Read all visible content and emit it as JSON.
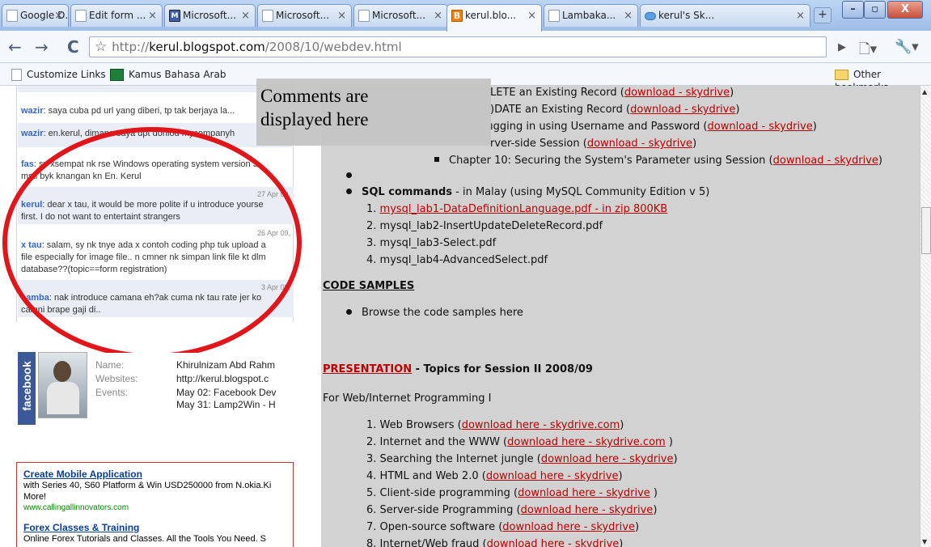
{
  "browser": {
    "tabs": [
      {
        "label": "Google D...",
        "icon": "page-icon"
      },
      {
        "label": "Edit form ...",
        "icon": "page-icon"
      },
      {
        "label": "Microsoft...",
        "icon": "ms-icon"
      },
      {
        "label": "Microsoft...",
        "icon": "page-icon"
      },
      {
        "label": "Microsoft...",
        "icon": "page-icon"
      },
      {
        "label": "kerul.blo...",
        "icon": "blogger-icon",
        "active": true
      },
      {
        "label": "Lambaka...",
        "icon": "page-icon"
      },
      {
        "label": "kerul's Sk...",
        "icon": "skydrive-icon"
      }
    ],
    "tab_close": "×",
    "new_tab": "+",
    "window_buttons": {
      "minimize": "–",
      "maximize": "▫",
      "close": "X"
    },
    "nav": {
      "back": "←",
      "forward": "→",
      "reload": "C",
      "star": "☆"
    },
    "url": {
      "scheme": "http://",
      "host": "kerul.blogspot.com",
      "path": "/2008/10/webdev.html"
    },
    "tools": {
      "play": "▶",
      "page": "🗋▾",
      "wrench": "🔧▾"
    },
    "bookmarks": [
      {
        "label": "Customize Links"
      },
      {
        "label": "Kamus Bahasa Arab"
      }
    ],
    "other_bookmarks": "Other bookmarks"
  },
  "comments": [
    {
      "user": "wazir",
      "text": ": saya cuba pd url yang diberi, tp tak berjaya la...",
      "date": ""
    },
    {
      "user": "wazir",
      "text": ": en.kerul, dimana saya dpt donlod mycompanyh",
      "date": ""
    },
    {
      "user": "fas",
      "text": ": sy xsempat nk rse Windows operating system version 3.",
      "text2": "msti byk knangan kn En. Kerul",
      "date": ""
    },
    {
      "user": "kerul",
      "text": ": dear x tau, it would be more polite if u introduce yourse",
      "text2": "first. I do not want to entertaint strangers",
      "date": "27 Apr 09,"
    },
    {
      "user": "x tau",
      "text": ": salam, sy nk tnye ada x contoh coding php tuk upload a",
      "text2": "file especially for image file.. n cmner nk simpan link file kt dlm",
      "text3": "database??(topic==form registration)",
      "date": "26 Apr 09,"
    },
    {
      "user": "samba",
      "text": ": nak introduce camana eh?ak cuma nk tau rate jer ko",
      "text2": "camni brape gaji di..",
      "date": "3 Apr 09,"
    }
  ],
  "annotation": {
    "line1": "Comments are",
    "line2": "displayed here",
    "ring_color": "#e0161b"
  },
  "profile": {
    "badge": "facebook",
    "labels": {
      "name": "Name:",
      "websites": "Websites:",
      "events": "Events:"
    },
    "name": "Khirulnizam Abd Rahm",
    "website": "http://kerul.blogspot.c",
    "event1": "May 02: Facebook Dev",
    "event2": "May 31: Lamp2Win - H"
  },
  "ads": [
    {
      "title": "Create Mobile Application",
      "body": "with Series 40, S60 Platform & Win USD250000 from N.okia.Ki",
      "body2": "More!",
      "url": "www.callingallinnovators.com"
    },
    {
      "title": "Forex Classes & Training",
      "body": "Online Forex Tutorials and Classes. All the Tools You Need. S"
    }
  ],
  "content": {
    "chapters": [
      {
        "text": "LETE an Existing Record (",
        "link": "download - skydrive",
        "tail": ")"
      },
      {
        "text": ")DATE an Existing Record (",
        "link": "download - skydrive",
        "tail": ")"
      },
      {
        "text": "ıgging in using Username and Password (",
        "link": "download - skydrive",
        "tail": ")"
      },
      {
        "text": "rver-side Session (",
        "link": "download - skydrive",
        "tail": ")"
      },
      {
        "text": "Chapter 10: Securing the System's Parameter using Session (",
        "link": "download - skydrive",
        "tail": ")"
      }
    ],
    "sql": {
      "title": "SQL commands",
      "desc": " - in Malay (using MySQL Community Edition v 5)",
      "items": [
        {
          "num": "1.",
          "text": "mysql_lab1-DataDefinitionLanguage.pdf - in zip 800KB",
          "link": true
        },
        {
          "num": "2.",
          "text": "mysql_lab2-InsertUpdateDeleteRecord.pdf"
        },
        {
          "num": "3.",
          "text": "mysql_lab3-Select.pdf"
        },
        {
          "num": "4.",
          "text": "mysql_lab4-AdvancedSelect.pdf"
        }
      ]
    },
    "code_heading": "CODE SAMPLES",
    "code_item": "Browse the code samples here",
    "presentation": {
      "title": "PRESENTATION",
      "desc": " - Topics for Session II 2008/09"
    },
    "for_line": "For Web/Internet Programming I",
    "topics": [
      {
        "num": "1.",
        "text": "Web Browsers (",
        "link": "download here - skydrive.com",
        "tail": ")"
      },
      {
        "num": "2.",
        "text": "Internet and the WWW (",
        "link": "download here - skydrive.com",
        "tail": " )"
      },
      {
        "num": "3.",
        "text": "Searching the Internet jungle (",
        "link": "download here - skydrive",
        "tail": ")"
      },
      {
        "num": "4.",
        "text": "HTML and Web 2.0 (",
        "link": "download here - skydrive",
        "tail": ")"
      },
      {
        "num": "5.",
        "text": "Client-side programming (",
        "link": "download here - skydrive",
        "tail": " )"
      },
      {
        "num": "6.",
        "text": "Server-side Programming (",
        "link": "download here - skydrive",
        "tail": ")"
      },
      {
        "num": "7.",
        "text": "Open-source software (",
        "link": "download here - skydrive",
        "tail": ")"
      },
      {
        "num": "8.",
        "text": "Internet/Web fraud (",
        "link": "download here - skydrive",
        "tail": ")"
      }
    ]
  }
}
